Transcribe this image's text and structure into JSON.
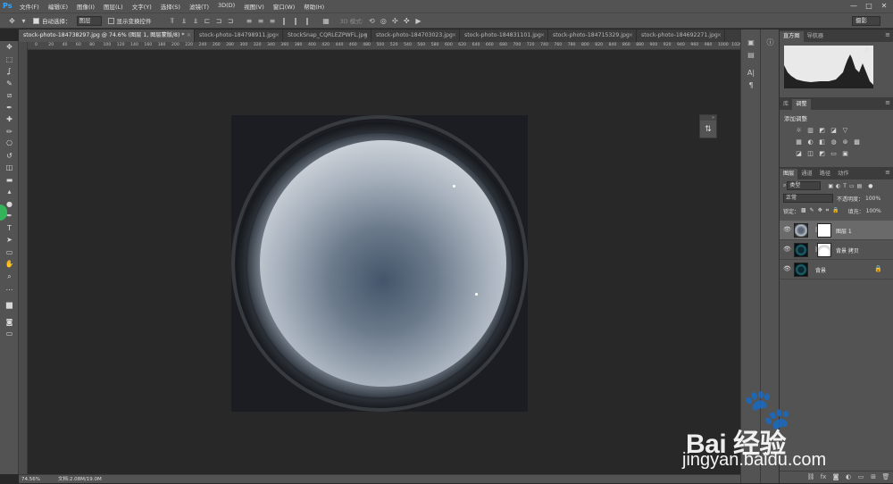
{
  "app": {
    "logo": "Ps"
  },
  "menu": [
    "文件(F)",
    "编辑(E)",
    "图像(I)",
    "图层(L)",
    "文字(Y)",
    "选择(S)",
    "滤镜(T)",
    "3D(D)",
    "视图(V)",
    "窗口(W)",
    "帮助(H)"
  ],
  "window_controls": [
    "—",
    "□",
    "✕"
  ],
  "options": {
    "auto_select_label": "自动选择：",
    "auto_select_value": "图层",
    "show_transform_label": "显示变换控件",
    "mode_3d": "3D 模式:",
    "workspace": "摄影"
  },
  "tabs": [
    {
      "label": "stock-photo-184738297.jpg @ 74.6% (图层 1, 图层蒙版/8) *",
      "close": "×"
    },
    {
      "label": "stock-photo-184798911.jpg",
      "close": "×"
    },
    {
      "label": "StockSnap_CQRLEZPWFL.jpg",
      "close": "×"
    },
    {
      "label": "stock-photo-184703023.jpg",
      "close": "×"
    },
    {
      "label": "stock-photo-184831101.jpg",
      "close": "×"
    },
    {
      "label": "stock-photo-184715329.jpg",
      "close": "×"
    },
    {
      "label": "stock-photo-184692271.jpg",
      "close": "×"
    }
  ],
  "ruler_ticks": [
    "0",
    "20",
    "40",
    "60",
    "80",
    "100",
    "120",
    "140",
    "160",
    "180",
    "200",
    "220",
    "240",
    "260",
    "280",
    "300",
    "320",
    "340",
    "360",
    "380",
    "400",
    "420",
    "440",
    "460",
    "480",
    "500",
    "520",
    "540",
    "560",
    "580",
    "600",
    "620",
    "640",
    "660",
    "680",
    "700",
    "720",
    "740",
    "760",
    "780",
    "800",
    "820",
    "840",
    "860",
    "880",
    "900",
    "920",
    "940",
    "960",
    "980",
    "1000",
    "1020"
  ],
  "tools": [
    "move-tool",
    "marquee-tool",
    "lasso-tool",
    "quick-select-tool",
    "crop-tool",
    "eyedropper-tool",
    "healing-brush-tool",
    "brush-tool",
    "clone-stamp-tool",
    "history-brush-tool",
    "eraser-tool",
    "gradient-tool",
    "blur-tool",
    "dodge-tool",
    "pen-tool",
    "type-tool",
    "path-select-tool",
    "rectangle-tool",
    "hand-tool",
    "zoom-tool",
    "more-tools",
    "color-swatches",
    "quick-mask-mode",
    "screen-mode"
  ],
  "status": {
    "zoom": "74.56%",
    "doc": "文档:2.08M/19.0M"
  },
  "right_panels": {
    "top_tabs": [
      "直方图",
      "导航器"
    ],
    "mid_tabs": [
      "库",
      "调整"
    ],
    "adjust_title": "添加调整",
    "layer_tabs": [
      "图层",
      "通道",
      "路径",
      "动作"
    ],
    "filter_kind": "类型",
    "blend_mode": "正常",
    "opacity_label": "不透明度：",
    "opacity_value": "100%",
    "lock_label": "锁定：",
    "fill_label": "填充：",
    "fill_value": "100%",
    "layers": [
      {
        "name": "图层 1",
        "selected": true,
        "has_mask": true
      },
      {
        "name": "背景 拷贝",
        "selected": false,
        "has_mask": true
      },
      {
        "name": "背景",
        "selected": false,
        "has_mask": false,
        "locked": true
      }
    ]
  },
  "watermark": {
    "brand": "Bai   经验",
    "url": "jingyan.baidu.com"
  }
}
